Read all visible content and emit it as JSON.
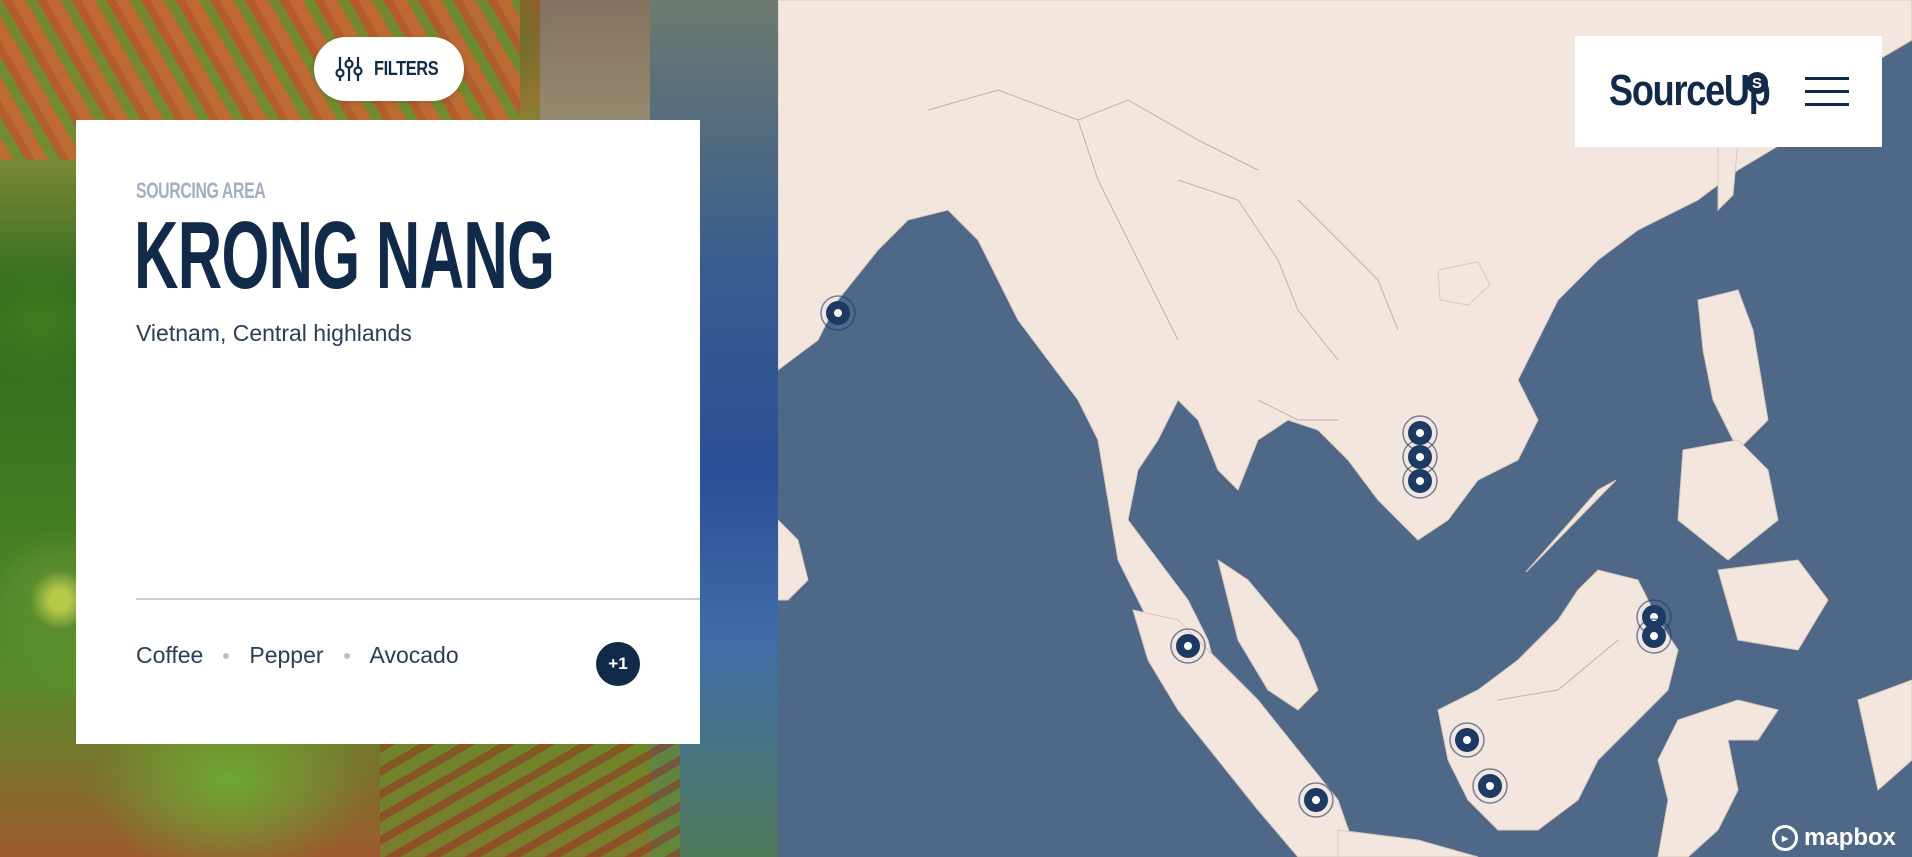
{
  "filters": {
    "label": "FILTERS",
    "icon": "sliders-icon"
  },
  "card": {
    "kicker": "SOURCING AREA",
    "title": "KRONG NANG",
    "subtitle": "Vietnam, Central highlands",
    "tags": [
      "Coffee",
      "Pepper",
      "Avocado"
    ],
    "more_badge": "+1"
  },
  "header": {
    "logo_text": "SourceUp",
    "logo_mark": "S",
    "menu_icon": "hamburger-menu-icon"
  },
  "map": {
    "attribution": "mapbox",
    "marker_count": 11,
    "colors": {
      "water": "#4f6888",
      "land": "#f3e6de",
      "marker": "#1c3a63",
      "text_dark": "#122a49"
    }
  }
}
